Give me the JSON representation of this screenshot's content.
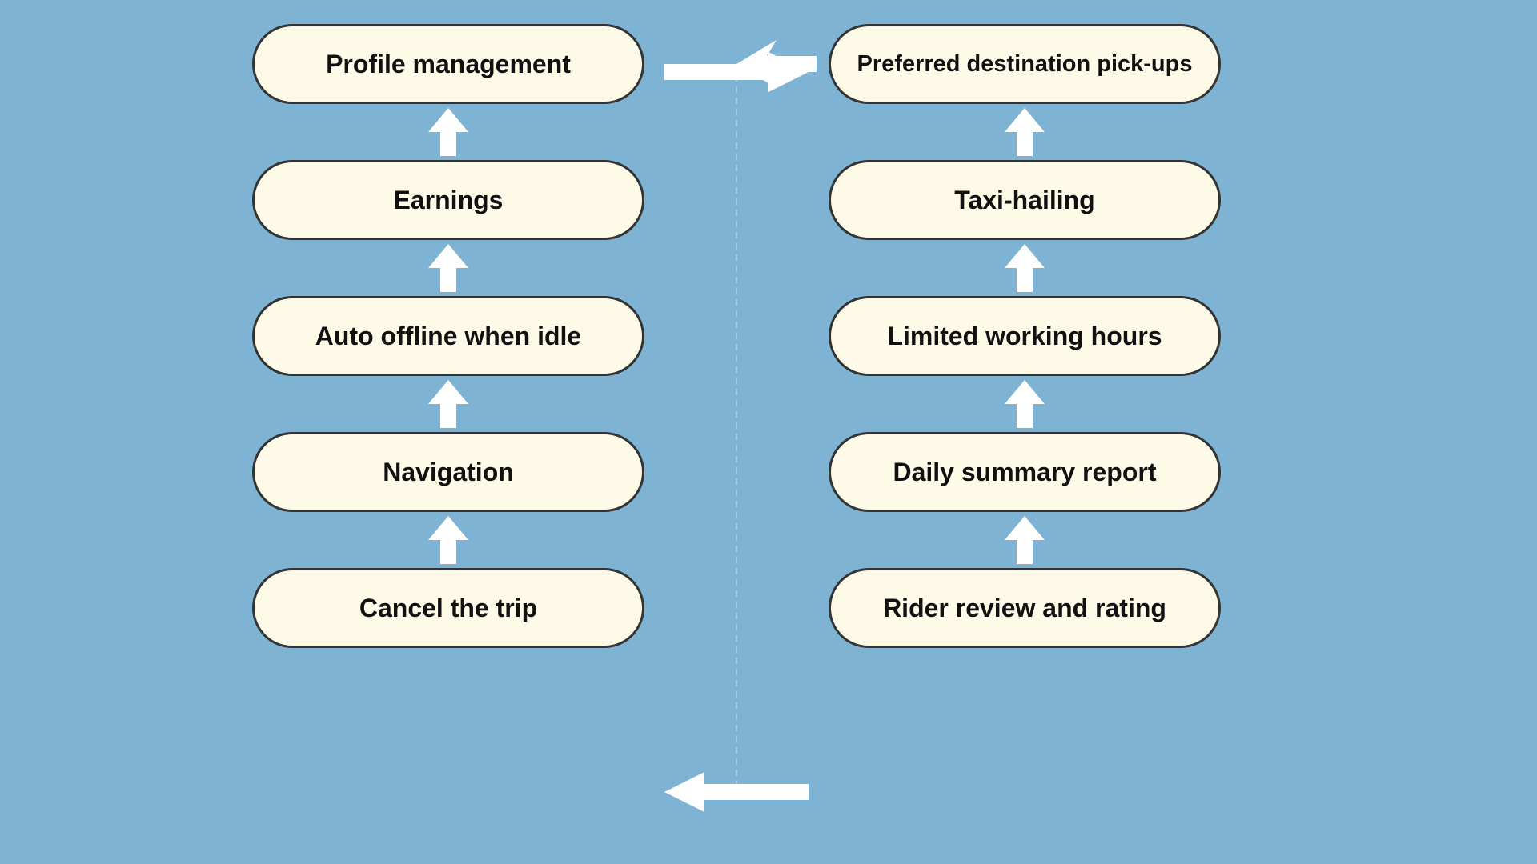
{
  "background": "#7fb3d3",
  "leftColumn": {
    "items": [
      {
        "id": "profile-management",
        "label": "Profile management"
      },
      {
        "id": "earnings",
        "label": "Earnings"
      },
      {
        "id": "auto-offline",
        "label": "Auto offline when idle"
      },
      {
        "id": "navigation",
        "label": "Navigation"
      },
      {
        "id": "cancel-trip",
        "label": "Cancel the trip"
      }
    ]
  },
  "rightColumn": {
    "items": [
      {
        "id": "preferred-destination",
        "label": "Preferred destination pick-ups"
      },
      {
        "id": "taxi-hailing",
        "label": "Taxi-hailing"
      },
      {
        "id": "limited-working-hours",
        "label": "Limited working hours"
      },
      {
        "id": "daily-summary",
        "label": "Daily summary report"
      },
      {
        "id": "rider-review",
        "label": "Rider review and rating"
      }
    ]
  },
  "arrowColor": "white"
}
